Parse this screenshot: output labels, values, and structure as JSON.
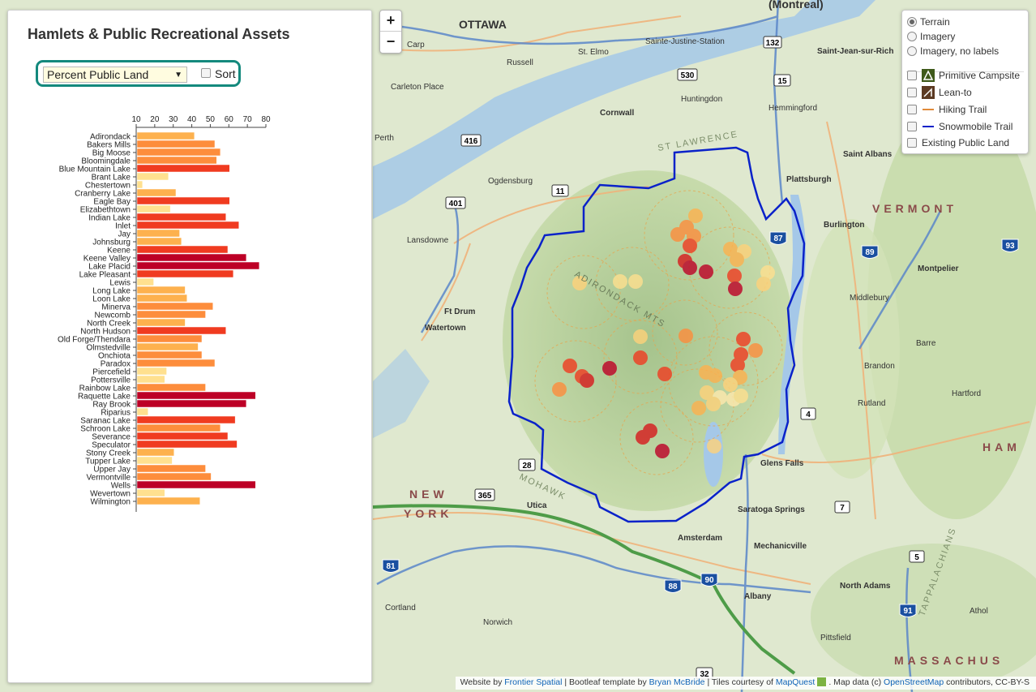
{
  "sidebar": {
    "title": "Hamlets & Public Recreational Assets",
    "metric_selected": "Percent Public Land",
    "sort_label": "Sort"
  },
  "chart_data": {
    "type": "bar",
    "orientation": "horizontal",
    "x_ticks": [
      "10",
      "20",
      "30",
      "40",
      "50",
      "60",
      "70",
      "80"
    ],
    "xlim": [
      10,
      80
    ],
    "categories": [
      "Adirondack",
      "Bakers Mills",
      "Big Moose",
      "Bloomingdale",
      "Blue Mountain Lake",
      "Brant Lake",
      "Chestertown",
      "Cranberry Lake",
      "Eagle Bay",
      "Elizabethtown",
      "Indian Lake",
      "Inlet",
      "Jay",
      "Johnsburg",
      "Keene",
      "Keene Valley",
      "Lake Placid",
      "Lake Pleasant",
      "Lewis",
      "Long Lake",
      "Loon Lake",
      "Minerva",
      "Newcomb",
      "North Creek",
      "North Hudson",
      "Old Forge/Thendara",
      "Olmstedville",
      "Onchiota",
      "Paradox",
      "Piercefield",
      "Pottersville",
      "Rainbow Lake",
      "Raquette Lake",
      "Ray Brook",
      "Riparius",
      "Saranac Lake",
      "Schroon Lake",
      "Severance",
      "Speculator",
      "Stony Creek",
      "Tupper Lake",
      "Upper Jay",
      "Vermontville",
      "Wells",
      "Wevertown",
      "Wilmington"
    ],
    "values": [
      41,
      52,
      55,
      53,
      60,
      27,
      13,
      31,
      60,
      28,
      58,
      65,
      33,
      34,
      59,
      69,
      76,
      62,
      19,
      36,
      37,
      51,
      47,
      36,
      58,
      45,
      43,
      45,
      52,
      26,
      25,
      47,
      74,
      69,
      16,
      63,
      55,
      59,
      64,
      30,
      29,
      47,
      50,
      74,
      25,
      44
    ],
    "color_scale": [
      "#ffe08f",
      "#fdb14e",
      "#fd8d3c",
      "#f03b20",
      "#bd0026"
    ]
  },
  "map": {
    "zoom_in": "+",
    "zoom_out": "−",
    "labels": [
      {
        "text": "OTTAWA",
        "kind": "city"
      },
      {
        "text": "(Montreal)",
        "kind": "city"
      },
      {
        "text": "Carp",
        "kind": "town"
      },
      {
        "text": "Russell",
        "kind": "town"
      },
      {
        "text": "St. Elmo",
        "kind": "town"
      },
      {
        "text": "Sainte-Justine-Station",
        "kind": "town"
      },
      {
        "text": "Saint-Jean-sur-Rich",
        "kind": "town"
      },
      {
        "text": "Carleton Place",
        "kind": "town"
      },
      {
        "text": "Huntingdon",
        "kind": "town"
      },
      {
        "text": "Hemmingford",
        "kind": "town"
      },
      {
        "text": "Cornwall",
        "kind": "town"
      },
      {
        "text": "Perth",
        "kind": "town"
      },
      {
        "text": "Ogdensburg",
        "kind": "town"
      },
      {
        "text": "Plattsburgh",
        "kind": "town"
      },
      {
        "text": "Saint Albans",
        "kind": "town"
      },
      {
        "text": "VERMONT",
        "kind": "state"
      },
      {
        "text": "Burlington",
        "kind": "town"
      },
      {
        "text": "Lansdowne",
        "kind": "town"
      },
      {
        "text": "Montpelier",
        "kind": "town"
      },
      {
        "text": "Ft Drum",
        "kind": "town"
      },
      {
        "text": "Watertown",
        "kind": "town"
      },
      {
        "text": "Middlebury",
        "kind": "town"
      },
      {
        "text": "Barre",
        "kind": "town"
      },
      {
        "text": "Brandon",
        "kind": "town"
      },
      {
        "text": "Rutland",
        "kind": "town"
      },
      {
        "text": "Hartford",
        "kind": "town"
      },
      {
        "text": "Glens Falls",
        "kind": "town"
      },
      {
        "text": "NEW",
        "kind": "state"
      },
      {
        "text": "YORK",
        "kind": "state"
      },
      {
        "text": "Utica",
        "kind": "town"
      },
      {
        "text": "Saratoga Springs",
        "kind": "town"
      },
      {
        "text": "Amsterdam",
        "kind": "town"
      },
      {
        "text": "Mechanicville",
        "kind": "town"
      },
      {
        "text": "North Adams",
        "kind": "town"
      },
      {
        "text": "Albany",
        "kind": "town"
      },
      {
        "text": "Cortland",
        "kind": "town"
      },
      {
        "text": "Norwich",
        "kind": "town"
      },
      {
        "text": "Pittsfield",
        "kind": "town"
      },
      {
        "text": "Athol",
        "kind": "town"
      },
      {
        "text": "MASSACHUS",
        "kind": "state"
      },
      {
        "text": "HAM",
        "kind": "state"
      },
      {
        "text": "ST LAWRENCE",
        "kind": "terrain"
      },
      {
        "text": "ADIRONDACK MTS",
        "kind": "terrain"
      },
      {
        "text": "MOHAWK",
        "kind": "terrain"
      },
      {
        "text": "TAPPALACHIANS",
        "kind": "terrain"
      }
    ],
    "shields": [
      "132",
      "530",
      "15",
      "416",
      "401",
      "11",
      "87",
      "89",
      "93",
      "4",
      "28",
      "365",
      "7",
      "5",
      "81",
      "88",
      "90",
      "91",
      "32"
    ]
  },
  "layers": {
    "basemaps": [
      {
        "label": "Terrain",
        "selected": true
      },
      {
        "label": "Imagery",
        "selected": false
      },
      {
        "label": "Imagery, no labels",
        "selected": false
      }
    ],
    "overlays": [
      {
        "label": "Primitive Campsite",
        "icon": "campsite-icon"
      },
      {
        "label": "Lean-to",
        "icon": "lean-to-icon"
      },
      {
        "label": "Hiking Trail",
        "icon": "hiking-trail-icon"
      },
      {
        "label": "Snowmobile Trail",
        "icon": "snowmobile-trail-icon"
      },
      {
        "label": "Existing Public Land",
        "icon": ""
      }
    ]
  },
  "attribution": {
    "p1": "Website by ",
    "l1": "Frontier Spatial",
    "p2": " | Bootleaf template by ",
    "l2": "Bryan McBride",
    "p3": " | Tiles courtesy of ",
    "l3": "MapQuest",
    "p4": ". Map data (c) ",
    "l4": "OpenStreetMap",
    "p5": " contributors, CC-BY-S"
  },
  "colors": {
    "accent": "#14897d",
    "boundary": "#0a22c9",
    "water": "#a5c8e8"
  }
}
